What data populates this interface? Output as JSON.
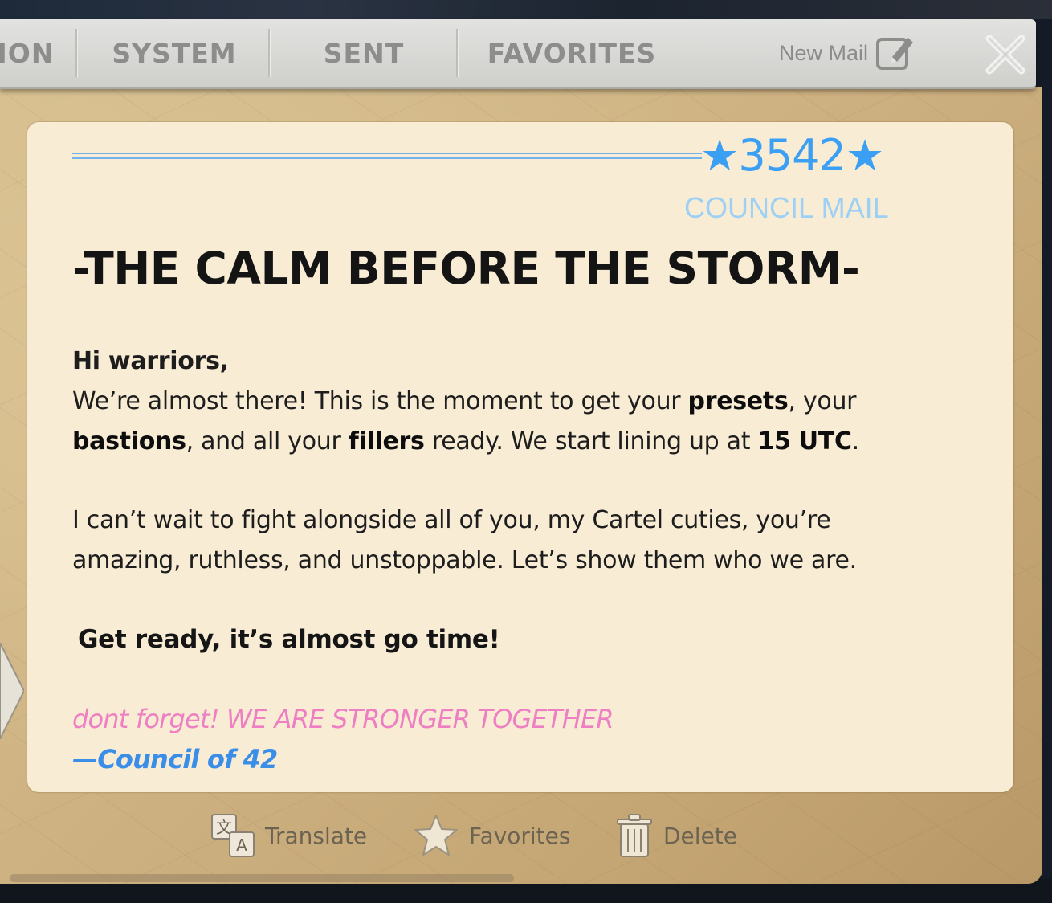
{
  "tabs": [
    {
      "label": "ION"
    },
    {
      "label": "SYSTEM"
    },
    {
      "label": "SENT"
    },
    {
      "label": "FAVORITES"
    }
  ],
  "toolbar": {
    "new_mail_label": "New Mail"
  },
  "mail": {
    "badge": "★3542★",
    "category": "COUNCIL MAIL",
    "title": "-THE CALM BEFORE THE STORM-",
    "greeting": "Hi warriors,",
    "para1": {
      "t1": "We’re almost there! This is the moment to get your ",
      "b1": "presets",
      "t2": ", your",
      "b2": "bastions",
      "t3": ", and all your ",
      "b3": "fillers",
      "t4": " ready. We start lining up at ",
      "b4": "15 UTC",
      "t5": "."
    },
    "para2_line1": "I can’t wait to fight alongside all of you, my Cartel cuties, you’re",
    "para2_line2": "amazing, ruthless, and unstoppable. Let’s show them who we are.",
    "ready_line": "Get ready, it’s almost go time!",
    "tagline": "dont forget! WE ARE STRONGER TOGETHER",
    "signature": "—Council of 42"
  },
  "actions": {
    "translate": "Translate",
    "favorites": "Favorites",
    "delete": "Delete"
  },
  "colors": {
    "accent_blue": "#3b9ff3",
    "pink": "#ee7fc3",
    "card_bg": "#f8ecd5"
  }
}
